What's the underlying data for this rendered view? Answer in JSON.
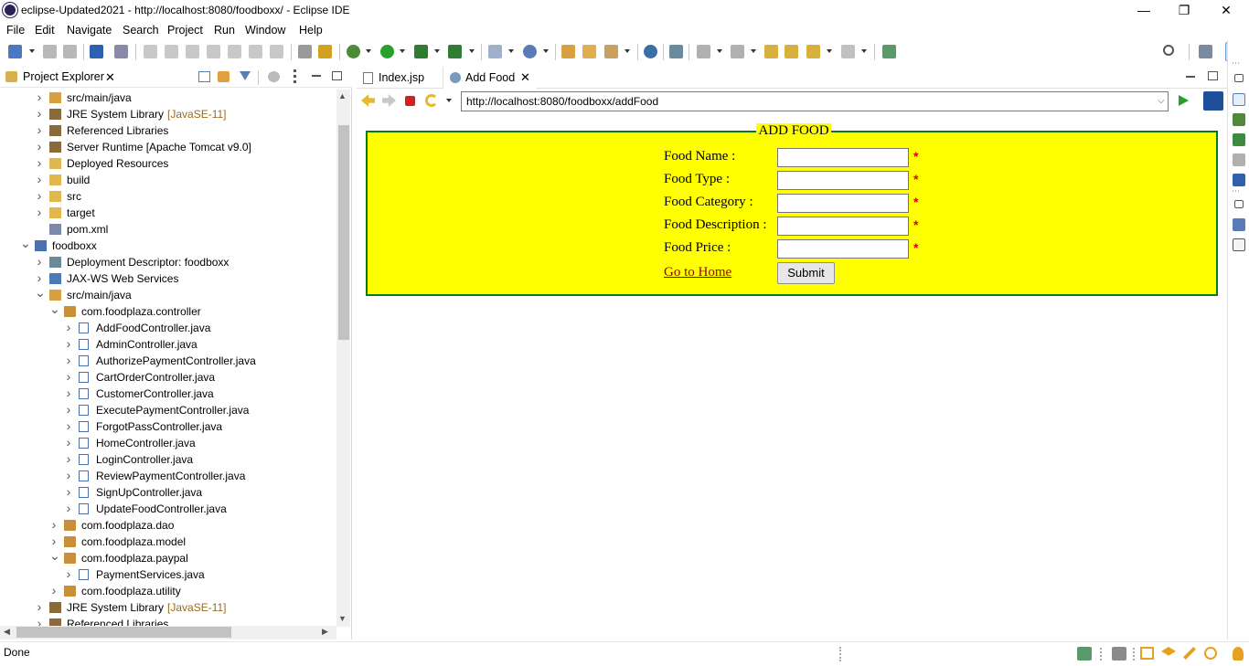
{
  "window": {
    "title": "eclipse-Updated2021 - http://localhost:8080/foodboxx/ - Eclipse IDE",
    "minimize": "—",
    "restore": "❐",
    "close": "✕"
  },
  "menu": [
    "File",
    "Edit",
    "Navigate",
    "Search",
    "Project",
    "Run",
    "Window",
    "Help"
  ],
  "explorer": {
    "title": "Project Explorer",
    "close": "✕",
    "items": [
      {
        "label": "src/main/java",
        "suffix": "",
        "indent": 1,
        "chev": ">",
        "icon": "package-folder"
      },
      {
        "label": "JRE System Library",
        "suffix": "[JavaSE-11]",
        "indent": 1,
        "chev": ">",
        "icon": "library"
      },
      {
        "label": "Referenced Libraries",
        "suffix": "",
        "indent": 1,
        "chev": ">",
        "icon": "library"
      },
      {
        "label": "Server Runtime [Apache Tomcat v9.0]",
        "suffix": "",
        "indent": 1,
        "chev": ">",
        "icon": "library"
      },
      {
        "label": "Deployed Resources",
        "suffix": "",
        "indent": 1,
        "chev": ">",
        "icon": "folder"
      },
      {
        "label": "build",
        "suffix": "",
        "indent": 1,
        "chev": ">",
        "icon": "folder"
      },
      {
        "label": "src",
        "suffix": "",
        "indent": 1,
        "chev": ">",
        "icon": "folder"
      },
      {
        "label": "target",
        "suffix": "",
        "indent": 1,
        "chev": ">",
        "icon": "folder"
      },
      {
        "label": "pom.xml",
        "suffix": "",
        "indent": 1,
        "chev": "",
        "icon": "xml"
      },
      {
        "label": "foodboxx",
        "suffix": "",
        "indent": 0,
        "chev": "v",
        "icon": "project"
      },
      {
        "label": "Deployment Descriptor: foodboxx",
        "suffix": "",
        "indent": 1,
        "chev": ">",
        "icon": "descriptor"
      },
      {
        "label": "JAX-WS Web Services",
        "suffix": "",
        "indent": 1,
        "chev": ">",
        "icon": "webservice"
      },
      {
        "label": "src/main/java",
        "suffix": "",
        "indent": 1,
        "chev": "v",
        "icon": "package-folder"
      },
      {
        "label": "com.foodplaza.controller",
        "suffix": "",
        "indent": 2,
        "chev": "v",
        "icon": "package"
      },
      {
        "label": "AddFoodController.java",
        "suffix": "",
        "indent": 3,
        "chev": ">",
        "icon": "java"
      },
      {
        "label": "AdminController.java",
        "suffix": "",
        "indent": 3,
        "chev": ">",
        "icon": "java"
      },
      {
        "label": "AuthorizePaymentController.java",
        "suffix": "",
        "indent": 3,
        "chev": ">",
        "icon": "java"
      },
      {
        "label": "CartOrderController.java",
        "suffix": "",
        "indent": 3,
        "chev": ">",
        "icon": "java"
      },
      {
        "label": "CustomerController.java",
        "suffix": "",
        "indent": 3,
        "chev": ">",
        "icon": "java"
      },
      {
        "label": "ExecutePaymentController.java",
        "suffix": "",
        "indent": 3,
        "chev": ">",
        "icon": "java"
      },
      {
        "label": "ForgotPassController.java",
        "suffix": "",
        "indent": 3,
        "chev": ">",
        "icon": "java"
      },
      {
        "label": "HomeController.java",
        "suffix": "",
        "indent": 3,
        "chev": ">",
        "icon": "java"
      },
      {
        "label": "LoginController.java",
        "suffix": "",
        "indent": 3,
        "chev": ">",
        "icon": "java"
      },
      {
        "label": "ReviewPaymentController.java",
        "suffix": "",
        "indent": 3,
        "chev": ">",
        "icon": "java"
      },
      {
        "label": "SignUpController.java",
        "suffix": "",
        "indent": 3,
        "chev": ">",
        "icon": "java"
      },
      {
        "label": "UpdateFoodController.java",
        "suffix": "",
        "indent": 3,
        "chev": ">",
        "icon": "java"
      },
      {
        "label": "com.foodplaza.dao",
        "suffix": "",
        "indent": 2,
        "chev": ">",
        "icon": "package"
      },
      {
        "label": "com.foodplaza.model",
        "suffix": "",
        "indent": 2,
        "chev": ">",
        "icon": "package"
      },
      {
        "label": "com.foodplaza.paypal",
        "suffix": "",
        "indent": 2,
        "chev": "v",
        "icon": "package"
      },
      {
        "label": "PaymentServices.java",
        "suffix": "",
        "indent": 3,
        "chev": ">",
        "icon": "java"
      },
      {
        "label": "com.foodplaza.utility",
        "suffix": "",
        "indent": 2,
        "chev": ">",
        "icon": "package"
      },
      {
        "label": "JRE System Library",
        "suffix": "[JavaSE-11]",
        "indent": 1,
        "chev": ">",
        "icon": "library"
      },
      {
        "label": "Referenced Libraries",
        "suffix": "",
        "indent": 1,
        "chev": ">",
        "icon": "library"
      }
    ]
  },
  "editor": {
    "tabs": [
      {
        "label": "Index.jsp",
        "active": false
      },
      {
        "label": "Add Food",
        "active": true,
        "close": "✕"
      }
    ],
    "url": "http://localhost:8080/foodboxx/addFood"
  },
  "form": {
    "legend": "ADD FOOD",
    "fields": [
      {
        "label": "Food Name :",
        "value": "",
        "required": "*"
      },
      {
        "label": "Food Type :",
        "value": "",
        "required": "*"
      },
      {
        "label": "Food Category :",
        "value": "",
        "required": "*"
      },
      {
        "label": "Food Description :",
        "value": "",
        "required": "*"
      },
      {
        "label": "Food Price :",
        "value": "",
        "required": "*"
      }
    ],
    "home_link": "Go to Home",
    "submit": "Submit"
  },
  "status": {
    "text": "Done"
  },
  "colors": {
    "form_bg": "#ffff00",
    "form_border": "#0a7a0a",
    "required": "#e00000",
    "link": "#990000"
  }
}
